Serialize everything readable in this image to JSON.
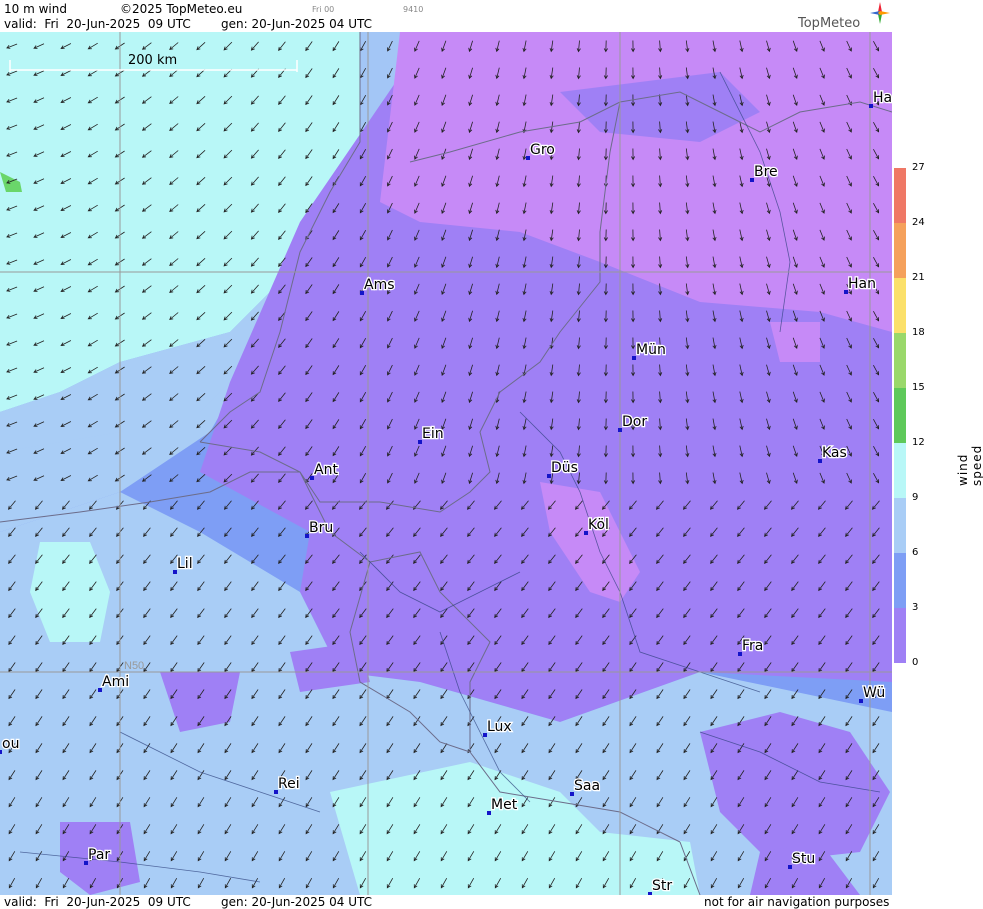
{
  "header": {
    "product": "10 m wind",
    "copyright": "©2025 TopMeteo.eu",
    "valid_line": "valid:  Fri  20-Jun-2025  09 UTC",
    "gen_line": "gen: 20-Jun-2025 04 UTC",
    "small_a": "Fri 00",
    "small_b": "9410"
  },
  "logo": {
    "text": "TopMeteo"
  },
  "scale_bar": {
    "label": "200 km"
  },
  "graticule": {
    "lat_label": "N50"
  },
  "cities": [
    {
      "name": "Ha"
    },
    {
      "name": "Gro"
    },
    {
      "name": "Bre"
    },
    {
      "name": "Ams"
    },
    {
      "name": "Han"
    },
    {
      "name": "Mün"
    },
    {
      "name": "Dor"
    },
    {
      "name": "Ein"
    },
    {
      "name": "Kas"
    },
    {
      "name": "Ant"
    },
    {
      "name": "Düs"
    },
    {
      "name": "Köl"
    },
    {
      "name": "Bru"
    },
    {
      "name": "Lil"
    },
    {
      "name": "Fra"
    },
    {
      "name": "Ami"
    },
    {
      "name": "Wü"
    },
    {
      "name": "Lux"
    },
    {
      "name": "ou"
    },
    {
      "name": "Rei"
    },
    {
      "name": "Saa"
    },
    {
      "name": "Met"
    },
    {
      "name": "Par"
    },
    {
      "name": "Stu"
    },
    {
      "name": "Str"
    }
  ],
  "legend": {
    "title": "wind  speed  [kt]",
    "ticks": [
      "27",
      "24",
      "21",
      "18",
      "15",
      "12",
      "9",
      "6",
      "3",
      "0"
    ],
    "colors": [
      "#ef7866",
      "#f5a15c",
      "#fbe06a",
      "#9ad86b",
      "#5ec95a",
      "#b8f7f7",
      "#a9cdf6",
      "#7e9ef5",
      "#9f80f5",
      "#c68af7"
    ]
  },
  "footer": {
    "valid_line": "valid:  Fri  20-Jun-2025  09 UTC",
    "gen_line": "gen: 20-Jun-2025 04 UTC",
    "disclaimer": "not for air navigation purposes"
  }
}
